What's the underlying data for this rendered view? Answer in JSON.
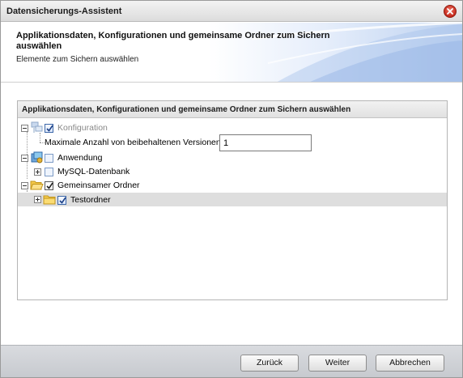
{
  "window": {
    "title": "Datensicherungs-Assistent"
  },
  "header": {
    "title": "Applikationsdaten, Konfigurationen und gemeinsame Ordner zum Sichern auswählen",
    "subtitle": "Elemente zum Sichern auswählen"
  },
  "panel": {
    "title": "Applikationsdaten, Konfigurationen und gemeinsame Ordner zum Sichern auswählen",
    "tree": [
      {
        "label": "Konfiguration",
        "checked": true,
        "expanded": true,
        "icon": "network-config-icon"
      },
      {
        "label": "Maximale Anzahl von beibehaltenen Versionen",
        "value": "1"
      },
      {
        "label": "Anwendung",
        "checked": false,
        "expanded": true,
        "icon": "application-icon"
      },
      {
        "label": "MySQL-Datenbank",
        "checked": false,
        "expanded": false
      },
      {
        "label": "Gemeinsamer Ordner",
        "checked": true,
        "expanded": true,
        "icon": "folder-open-icon"
      },
      {
        "label": "Testordner",
        "checked": true,
        "expanded": false,
        "selected": true,
        "icon": "folder-icon"
      }
    ]
  },
  "buttons": {
    "back": "Zurück",
    "next": "Weiter",
    "cancel": "Abbrechen"
  }
}
